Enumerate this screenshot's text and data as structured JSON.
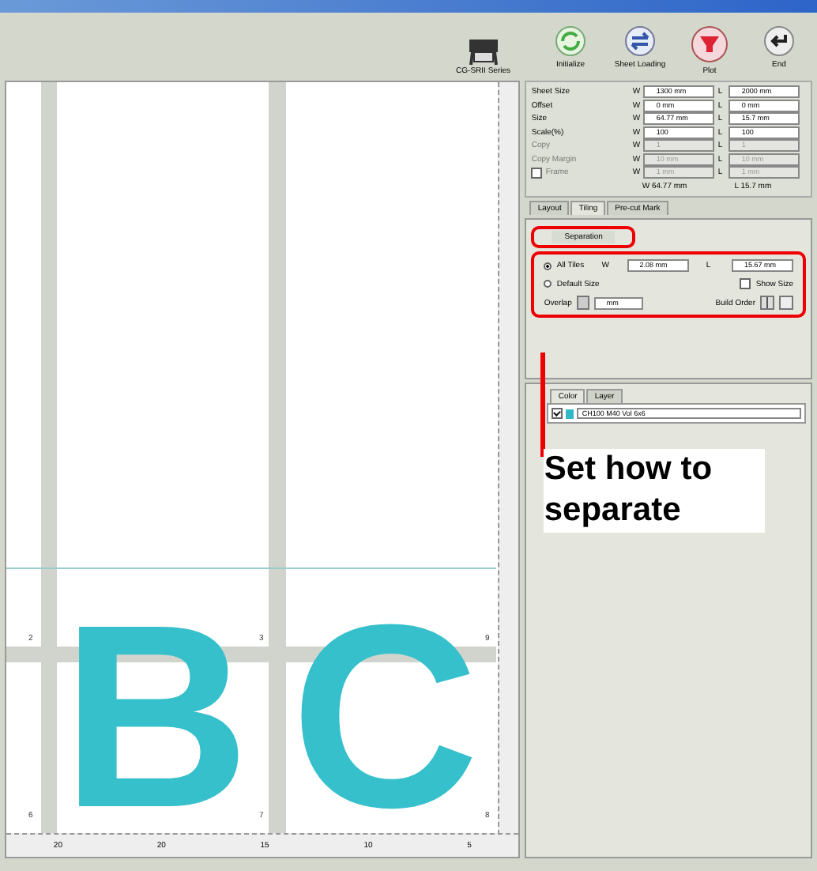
{
  "toolbar": {
    "device": "CG-SRII Series",
    "buttons": [
      {
        "kind": "init",
        "label": "Initialize"
      },
      {
        "kind": "sheet",
        "label": "Sheet Loading"
      },
      {
        "kind": "plot",
        "label": "Plot"
      },
      {
        "kind": "end",
        "label": "End"
      }
    ]
  },
  "canvas": {
    "artwork_letters": [
      "B",
      "C"
    ],
    "tile_numbers": [
      "2",
      "3",
      "9",
      "6",
      "7",
      "8"
    ],
    "ruler_labels": [
      "20",
      "20",
      "15",
      "10",
      "5"
    ]
  },
  "settings": {
    "rows": [
      {
        "label": "Sheet Size",
        "w_axis": "W",
        "w": "1300 mm",
        "l_axis": "L",
        "l": "2000 mm",
        "disabled": false,
        "kind": "plain"
      },
      {
        "label": "Offset",
        "w_axis": "W",
        "w": "0 mm",
        "l_axis": "L",
        "l": "0 mm",
        "disabled": false,
        "kind": "plain"
      },
      {
        "label": "Size",
        "w_axis": "W",
        "w": "64.77 mm",
        "l_axis": "L",
        "l": "15.7 mm",
        "disabled": false,
        "kind": "plain"
      },
      {
        "label": "Scale(%)",
        "w_axis": "W",
        "w": "100",
        "l_axis": "L",
        "l": "100",
        "disabled": false,
        "kind": "plain"
      },
      {
        "label": "Copy",
        "w_axis": "W",
        "w": "1",
        "l_axis": "L",
        "l": "1",
        "disabled": true,
        "kind": "plain"
      },
      {
        "label": "Copy Margin",
        "w_axis": "W",
        "w": "10 mm",
        "l_axis": "L",
        "l": "10 mm",
        "disabled": true,
        "kind": "plain"
      },
      {
        "label": "Frame",
        "w_axis": "W",
        "w": "1 mm",
        "l_axis": "L",
        "l": "1 mm",
        "disabled": true,
        "kind": "check",
        "checked": false
      }
    ],
    "total_w": "W 64.77 mm",
    "total_l": "L 15.7 mm"
  },
  "tabs": [
    {
      "label": "Layout",
      "selected": false
    },
    {
      "label": "Tiling",
      "selected": true
    },
    {
      "label": "Pre-cut Mark",
      "selected": false
    }
  ],
  "separation": {
    "tab": "Separation",
    "options": [
      {
        "label": "All Tiles",
        "selected": true
      },
      {
        "label": "Default Size",
        "selected": false
      }
    ],
    "w_axis": "W",
    "w": "2.08 mm",
    "l_axis": "L",
    "l": "15.67 mm",
    "show_size": {
      "label": "Show Size",
      "checked": false
    },
    "overlap_label": "Overlap",
    "overlap_value": "mm",
    "build_order_label": "Build Order"
  },
  "color_tabs": [
    {
      "label": "Color",
      "selected": true
    },
    {
      "label": "Layer",
      "selected": false
    }
  ],
  "color_row": {
    "checked": true,
    "color": "#33b8c8",
    "value": "CH100 M40 Vol 6x6"
  },
  "callout": "Set how to separate"
}
